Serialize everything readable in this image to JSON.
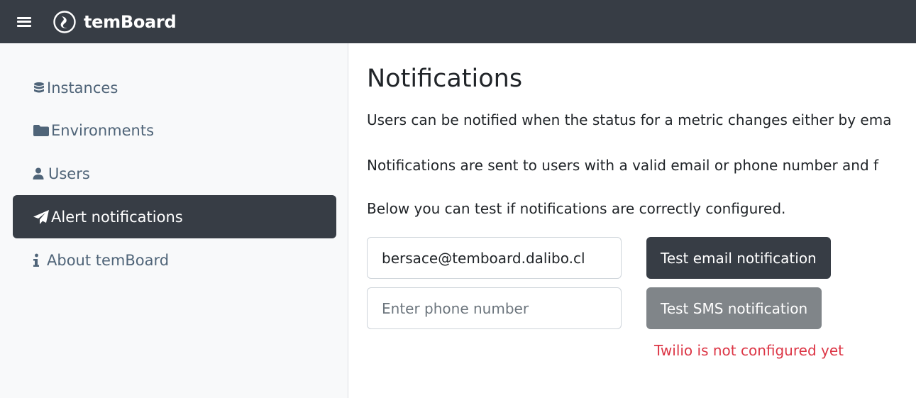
{
  "header": {
    "brand": "temBoard",
    "menu_icon": "hamburger-menu-icon",
    "logo_icon": "temboard-logo-icon"
  },
  "sidebar": {
    "items": [
      {
        "label": "Instances",
        "icon": "database-icon"
      },
      {
        "label": "Environments",
        "icon": "folder-icon"
      },
      {
        "label": "Users",
        "icon": "user-icon"
      },
      {
        "label": "Alert notifications",
        "icon": "paper-plane-icon",
        "active": true
      },
      {
        "label": "About temBoard",
        "icon": "info-icon"
      }
    ]
  },
  "main": {
    "title": "Notifications",
    "paragraphs": [
      "Users can be notified when the status for a metric changes either by ema",
      "Notifications are sent to users with a valid email or phone number and f",
      "Below you can test if notifications are correctly configured."
    ],
    "email_input": {
      "value": "bersace@temboard.dalibo.cl"
    },
    "phone_input": {
      "value": "",
      "placeholder": "Enter phone number"
    },
    "test_email_button": "Test email notification",
    "test_sms_button": "Test SMS notification",
    "sms_error": "Twilio is not configured yet"
  },
  "colors": {
    "topbar": "#373d45",
    "active_nav": "#373d45",
    "nav_text": "#4f6478",
    "error": "#dc3545",
    "disabled_button": "#808589"
  }
}
